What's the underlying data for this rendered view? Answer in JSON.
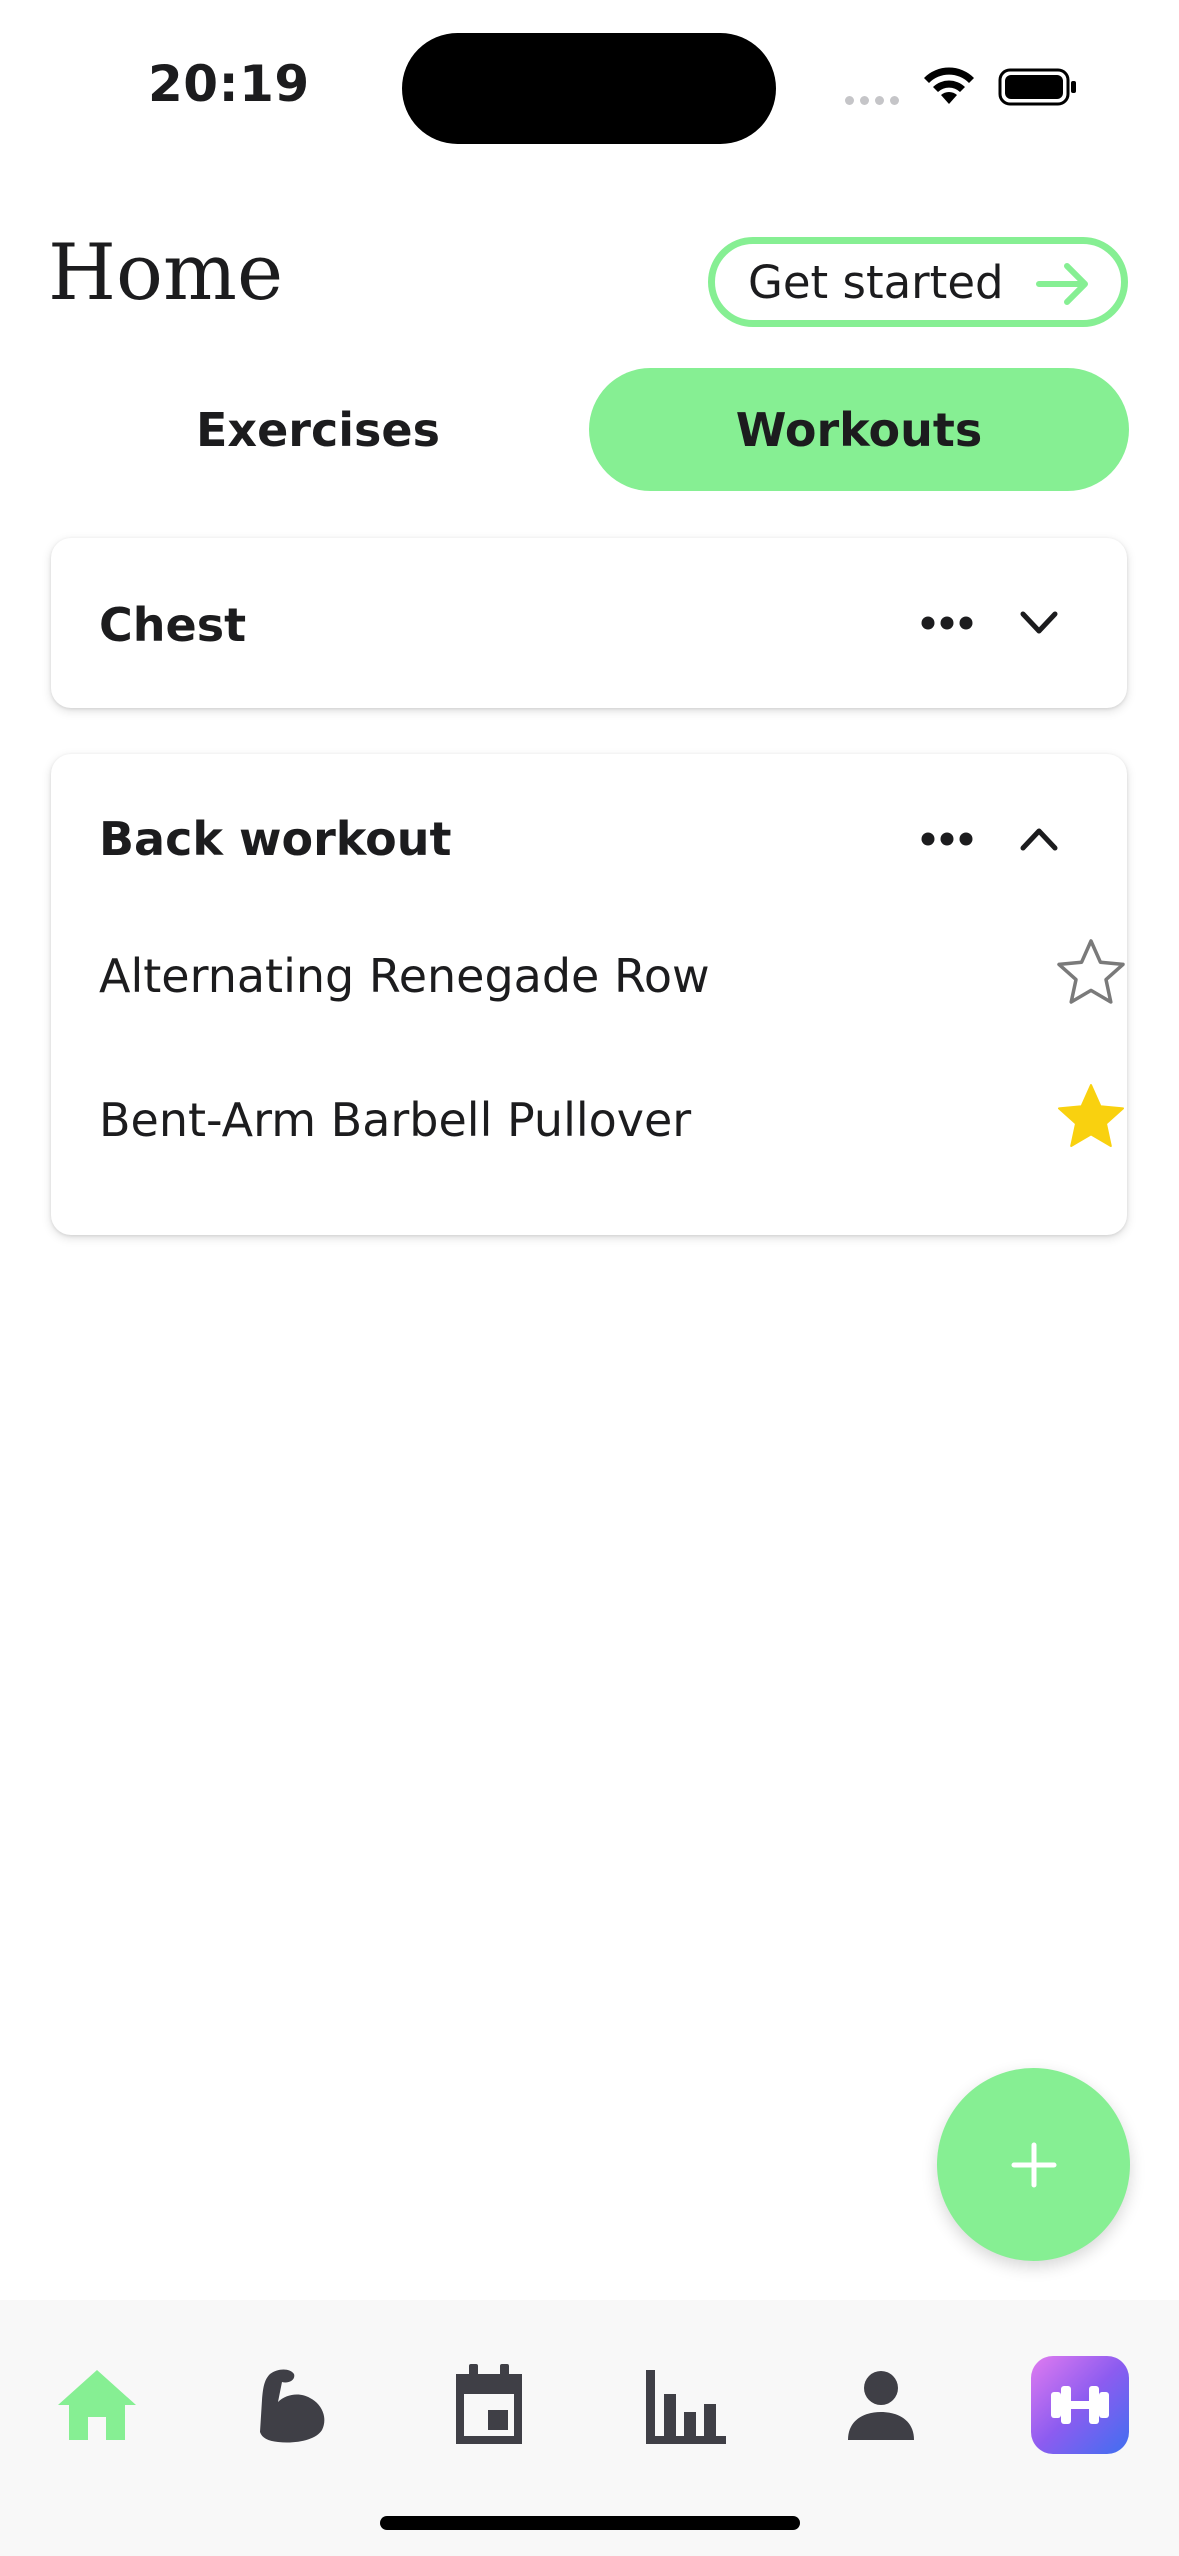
{
  "status_bar": {
    "time": "20:19"
  },
  "header": {
    "title": "Home",
    "cta_label": "Get started"
  },
  "tabs": [
    {
      "label": "Exercises",
      "active": false
    },
    {
      "label": "Workouts",
      "active": true
    }
  ],
  "workouts": [
    {
      "name": "Chest",
      "expanded": false,
      "exercises": []
    },
    {
      "name": "Back workout",
      "expanded": true,
      "exercises": [
        {
          "name": "Alternating Renegade Row",
          "favorite": false
        },
        {
          "name": "Bent-Arm Barbell Pullover",
          "favorite": true
        }
      ]
    }
  ],
  "colors": {
    "accent": "#86ef93",
    "favorite_star": "#f9d10f",
    "text": "#1c1c1e",
    "nav_icon": "#3f3f46"
  },
  "bottom_nav": {
    "items": [
      {
        "icon": "home-icon",
        "active": true
      },
      {
        "icon": "muscle-icon",
        "active": false
      },
      {
        "icon": "calendar-icon",
        "active": false
      },
      {
        "icon": "bar-chart-icon",
        "active": false
      },
      {
        "icon": "profile-icon",
        "active": false
      },
      {
        "icon": "dumbbell-app-icon",
        "active": false
      }
    ]
  },
  "fab": {
    "icon": "plus-icon"
  }
}
